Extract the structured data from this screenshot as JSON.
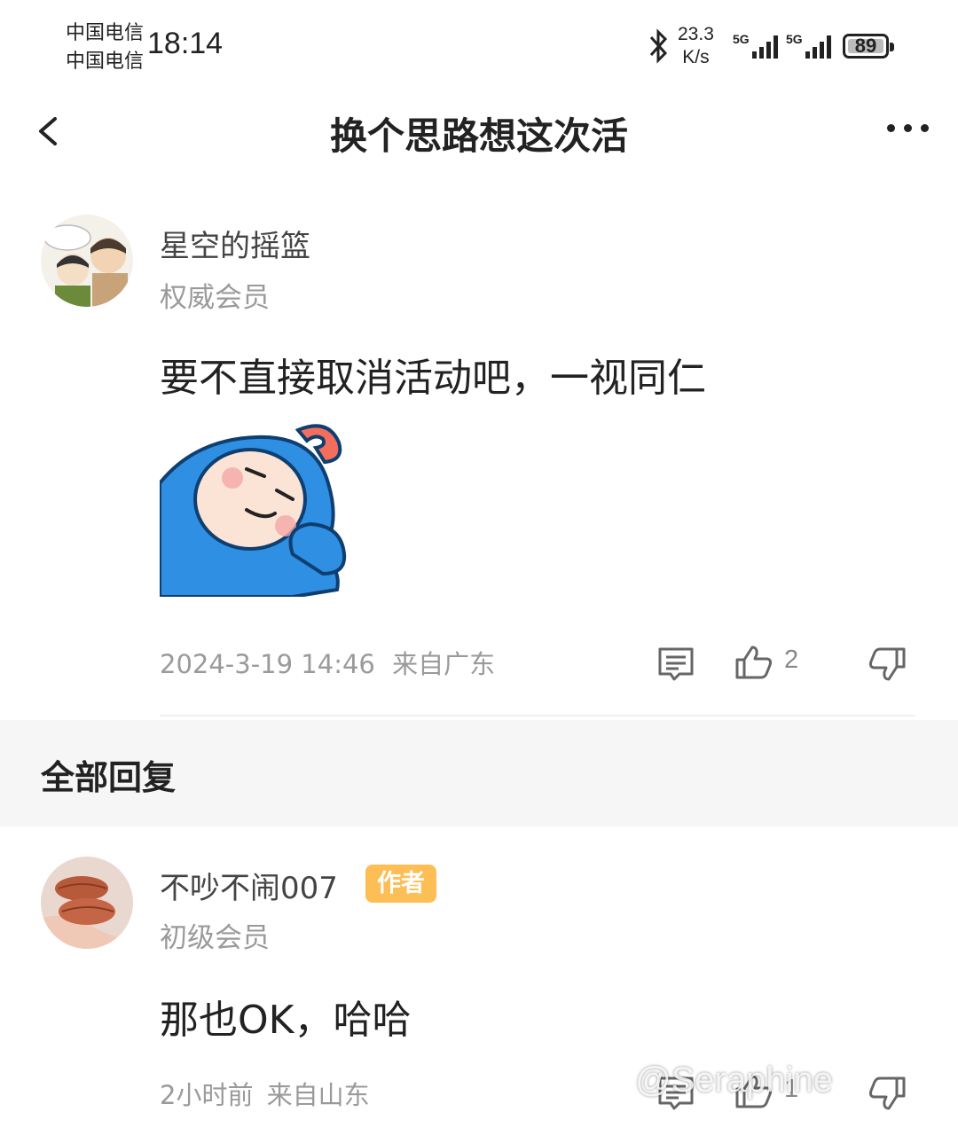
{
  "status_bar": {
    "carrier_1": "中国电信",
    "carrier_2": "中国电信",
    "time": "18:14",
    "net_speed_value": "23.3",
    "net_speed_unit": "K/s",
    "sim1_label": "5G",
    "sim2_label": "5G",
    "battery": "89"
  },
  "header": {
    "title": "换个思路想这次活",
    "back_icon": "chevron-left-icon",
    "more_icon": "more-dots-icon"
  },
  "post": {
    "username": "星空的摇篮",
    "level": "权威会员",
    "content": "要不直接取消活动吧，一视同仁",
    "timestamp": "2024-3-19 14:46",
    "location": "来自广东",
    "like_count": "2",
    "sticker": "blue-hooded-character-sticker"
  },
  "replies_section": {
    "heading": "全部回复"
  },
  "reply": {
    "username": "不吵不闹007",
    "badge": "作者",
    "level": "初级会员",
    "content": "那也OK，哈哈",
    "timestamp": "2小时前",
    "location": "来自山东",
    "like_count": "1"
  },
  "watermark": "@Seraphine",
  "colors": {
    "badge_bg": "#fdbf55",
    "section_bg": "#f6f6f6",
    "secondary_text": "#9a9a9a"
  }
}
